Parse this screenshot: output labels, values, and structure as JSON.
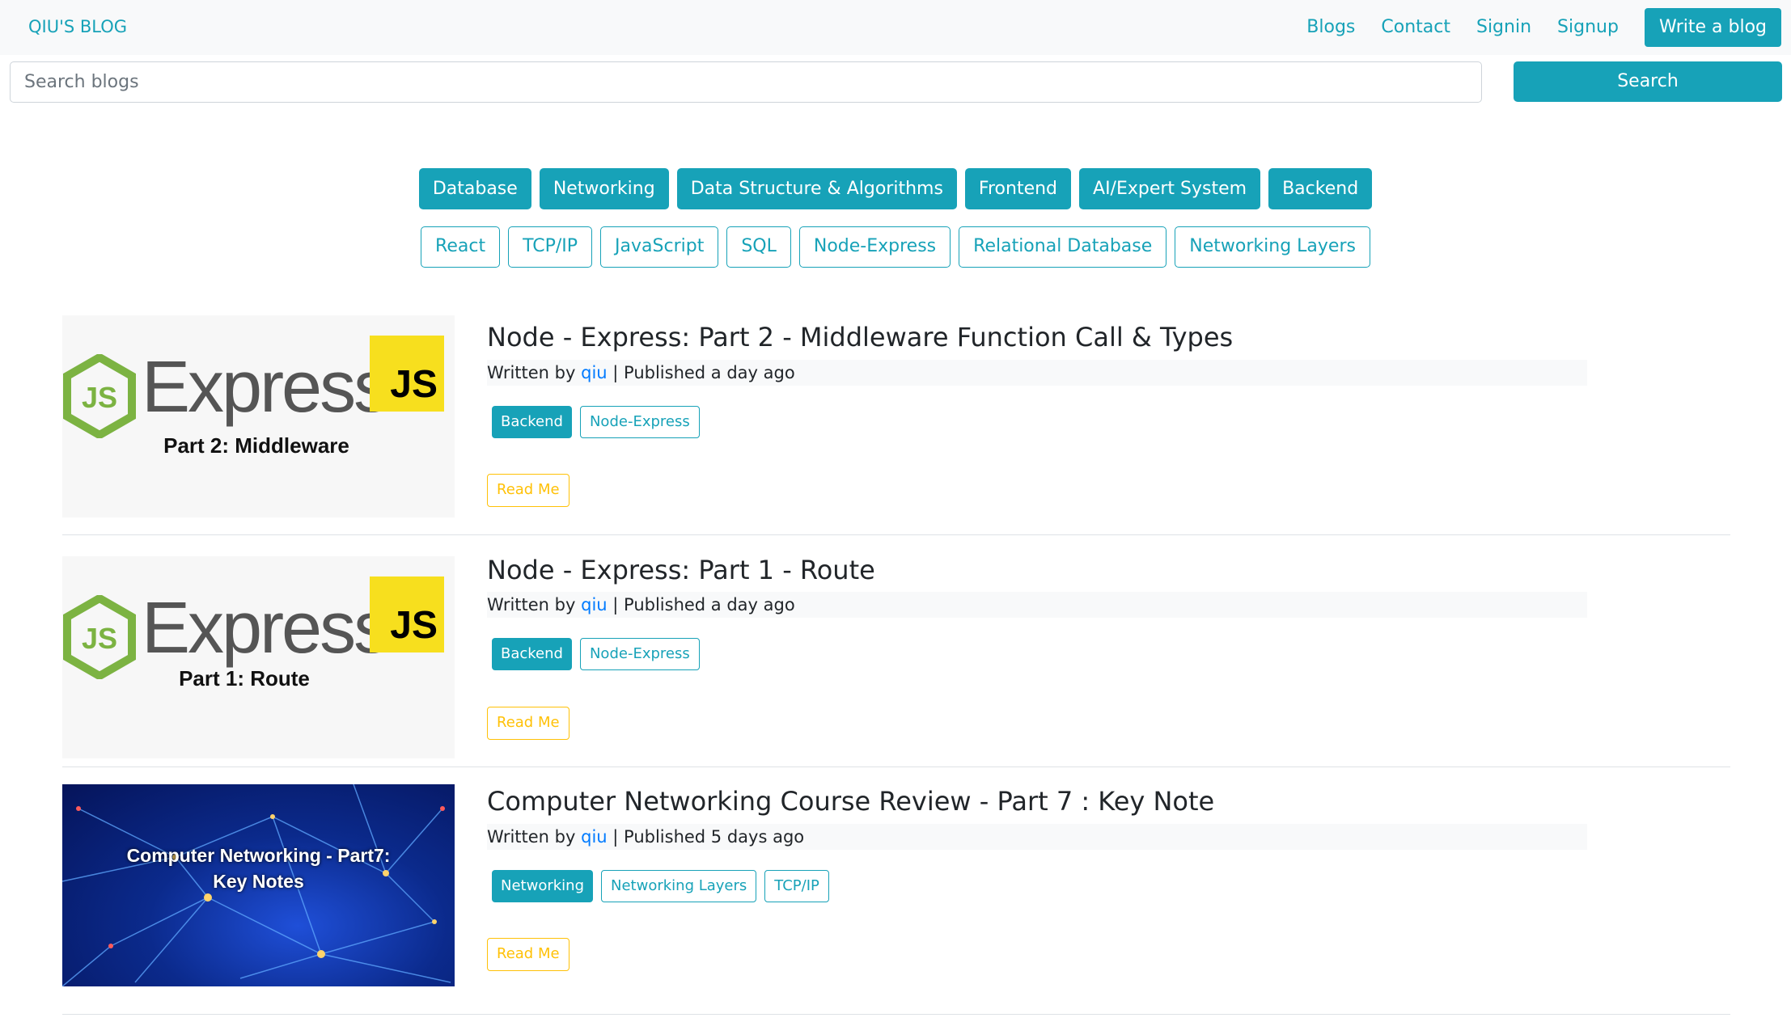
{
  "navbar": {
    "brand": "QIU'S BLOG",
    "links": [
      "Blogs",
      "Contact",
      "Signin",
      "Signup"
    ],
    "write_label": "Write a blog"
  },
  "search": {
    "placeholder": "Search blogs",
    "button_label": "Search"
  },
  "categories": [
    "Database",
    "Networking",
    "Data Structure & Algorithms",
    "Frontend",
    "AI/Expert System",
    "Backend"
  ],
  "tags": [
    "React",
    "TCP/IP",
    "JavaScript",
    "SQL",
    "Node-Express",
    "Relational Database",
    "Networking Layers"
  ],
  "colors": {
    "accent": "#17a2b8",
    "warning": "#ffc107",
    "link": "#007bff",
    "navbar_bg": "#f8f9fa"
  },
  "posts": [
    {
      "title": "Node - Express: Part 2 - Middleware Function Call & Types",
      "written_by": "Written by",
      "author": "qiu",
      "published": "| Published a day ago",
      "category": "Backend",
      "tags": [
        "Node-Express"
      ],
      "read_label": "Read Me",
      "thumb": {
        "word": "Express",
        "badge": "JS",
        "caption": "Part 2: Middleware"
      }
    },
    {
      "title": "Node - Express: Part 1 - Route",
      "written_by": "Written by",
      "author": "qiu",
      "published": "| Published a day ago",
      "category": "Backend",
      "tags": [
        "Node-Express"
      ],
      "read_label": "Read Me",
      "thumb": {
        "word": "Express",
        "badge": "JS",
        "caption": "Part 1: Route"
      }
    },
    {
      "title": "Computer Networking Course Review - Part 7 : Key Note",
      "written_by": "Written by",
      "author": "qiu",
      "published": "| Published 5 days ago",
      "category": "Networking",
      "tags": [
        "Networking Layers",
        "TCP/IP"
      ],
      "read_label": "Read Me",
      "thumb": {
        "caption_line1": "Computer Networking - Part7:",
        "caption_line2": "Key Notes"
      }
    }
  ]
}
